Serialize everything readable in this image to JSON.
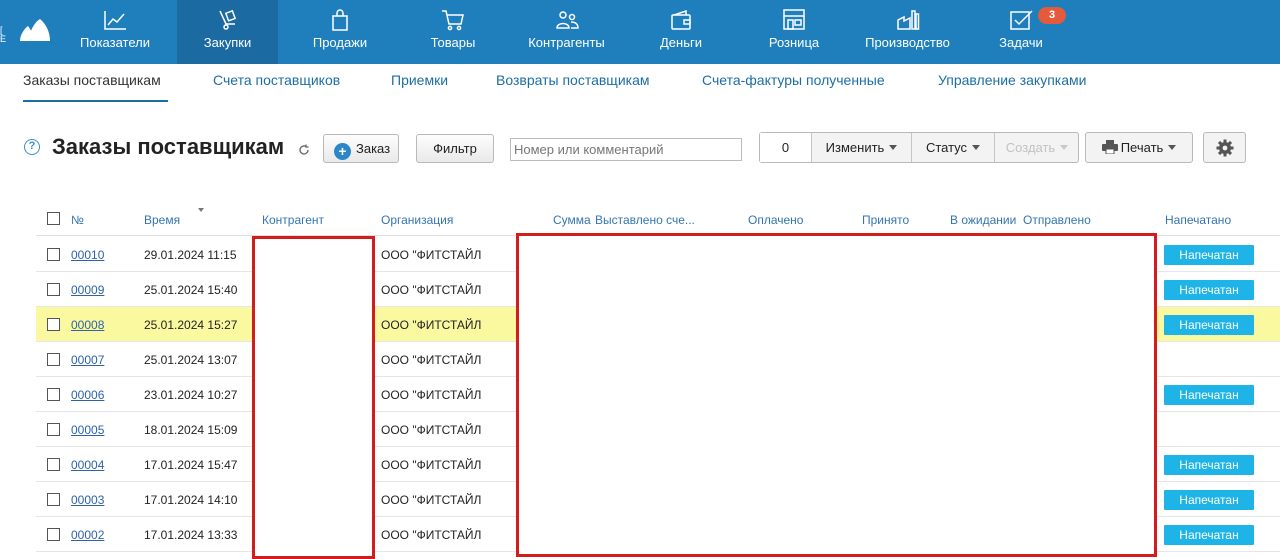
{
  "colors": {
    "topbar": "#1f7fbd",
    "topbar_active": "#1b6aa1",
    "link": "#2d63a8",
    "highlight_row": "#fbf9a0",
    "status_chip": "#1fb4e7",
    "badge": "#e45a3d",
    "redaction_border": "#d31c1c"
  },
  "topnav": {
    "items": [
      {
        "label": "Показатели",
        "icon": "chart-icon"
      },
      {
        "label": "Закупки",
        "icon": "cart-dolly-icon",
        "active": true
      },
      {
        "label": "Продажи",
        "icon": "shopping-bag-icon"
      },
      {
        "label": "Товары",
        "icon": "shopping-cart-icon"
      },
      {
        "label": "Контрагенты",
        "icon": "people-icon"
      },
      {
        "label": "Деньги",
        "icon": "wallet-icon"
      },
      {
        "label": "Розница",
        "icon": "storefront-icon"
      },
      {
        "label": "Производство",
        "icon": "factory-icon"
      },
      {
        "label": "Задачи",
        "icon": "checkbox-icon"
      }
    ],
    "tasks_badge": "3"
  },
  "subnav": {
    "tabs": [
      {
        "label": "Заказы поставщикам",
        "active": true
      },
      {
        "label": "Счета поставщиков"
      },
      {
        "label": "Приемки"
      },
      {
        "label": "Возвраты поставщикам"
      },
      {
        "label": "Счета-фактуры полученные"
      },
      {
        "label": "Управление закупками"
      }
    ]
  },
  "toolbar": {
    "help": "?",
    "title": "Заказы поставщикам",
    "add_order": "Заказ",
    "filter": "Фильтр",
    "search_placeholder": "Номер или комментарий",
    "selected_count": "0",
    "edit": "Изменить",
    "status": "Статус",
    "create": "Создать",
    "print": "Печать"
  },
  "table": {
    "columns": [
      "№",
      "Время",
      "Контрагент",
      "Организация",
      "Сумма",
      "Выставлено сче...",
      "Оплачено",
      "Принято",
      "В ожидании",
      "Отправлено",
      "Напечатано"
    ],
    "rows": [
      {
        "number": "00010",
        "time": "29.01.2024 11:15",
        "org": "ООО \"ФИТСТАЙЛ",
        "printed": "Напечатан"
      },
      {
        "number": "00009",
        "time": "25.01.2024 15:40",
        "org": "ООО \"ФИТСТАЙЛ",
        "printed": "Напечатан"
      },
      {
        "number": "00008",
        "time": "25.01.2024 15:27",
        "org": "ООО \"ФИТСТАЙЛ",
        "printed": "Напечатан",
        "highlighted": true
      },
      {
        "number": "00007",
        "time": "25.01.2024 13:07",
        "org": "ООО \"ФИТСТАЙЛ",
        "printed": ""
      },
      {
        "number": "00006",
        "time": "23.01.2024 10:27",
        "org": "ООО \"ФИТСТАЙЛ",
        "printed": "Напечатан"
      },
      {
        "number": "00005",
        "time": "18.01.2024 15:09",
        "org": "ООО \"ФИТСТАЙЛ",
        "printed": ""
      },
      {
        "number": "00004",
        "time": "17.01.2024 15:47",
        "org": "ООО \"ФИТСТАЙЛ",
        "printed": "Напечатан"
      },
      {
        "number": "00003",
        "time": "17.01.2024 14:10",
        "org": "ООО \"ФИТСТАЙЛ",
        "printed": "Напечатан"
      },
      {
        "number": "00002",
        "time": "17.01.2024 13:33",
        "org": "ООО \"ФИТСТАЙЛ",
        "printed": "Напечатан"
      }
    ]
  }
}
